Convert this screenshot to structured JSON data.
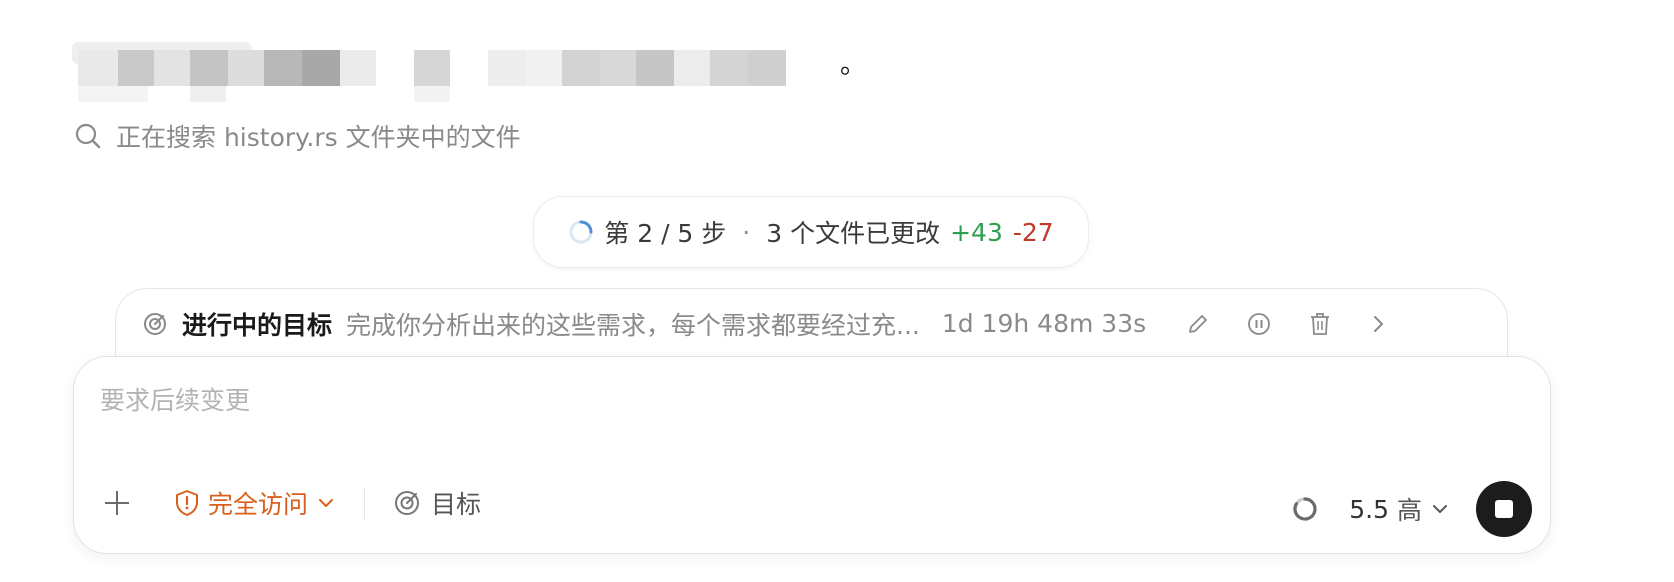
{
  "message": {
    "visible_tail": "。"
  },
  "search_status": {
    "text": "正在搜索 history.rs 文件夹中的文件",
    "icon": "search-icon"
  },
  "progress": {
    "step_label": "第 2 / 5 步",
    "separator": "·",
    "files_changed": "3 个文件已更改",
    "additions": "+43",
    "deletions": "-27"
  },
  "goal": {
    "title": "进行中的目标",
    "description": "完成你分析出来的这些需求，每个需求都要经过充...",
    "elapsed": "1d 19h 48m 33s",
    "icons": [
      "goal-icon",
      "edit-icon",
      "pause-icon",
      "delete-icon",
      "chevron-right-icon"
    ]
  },
  "composer": {
    "placeholder": "要求后续变更",
    "access_label": "完全访问",
    "goal_label": "目标",
    "model_version": "5.5",
    "reasoning_level": "高"
  },
  "colors": {
    "access_orange": "#d9601c",
    "additions_green": "#2f9e4f",
    "deletions_red": "#c0392b"
  }
}
